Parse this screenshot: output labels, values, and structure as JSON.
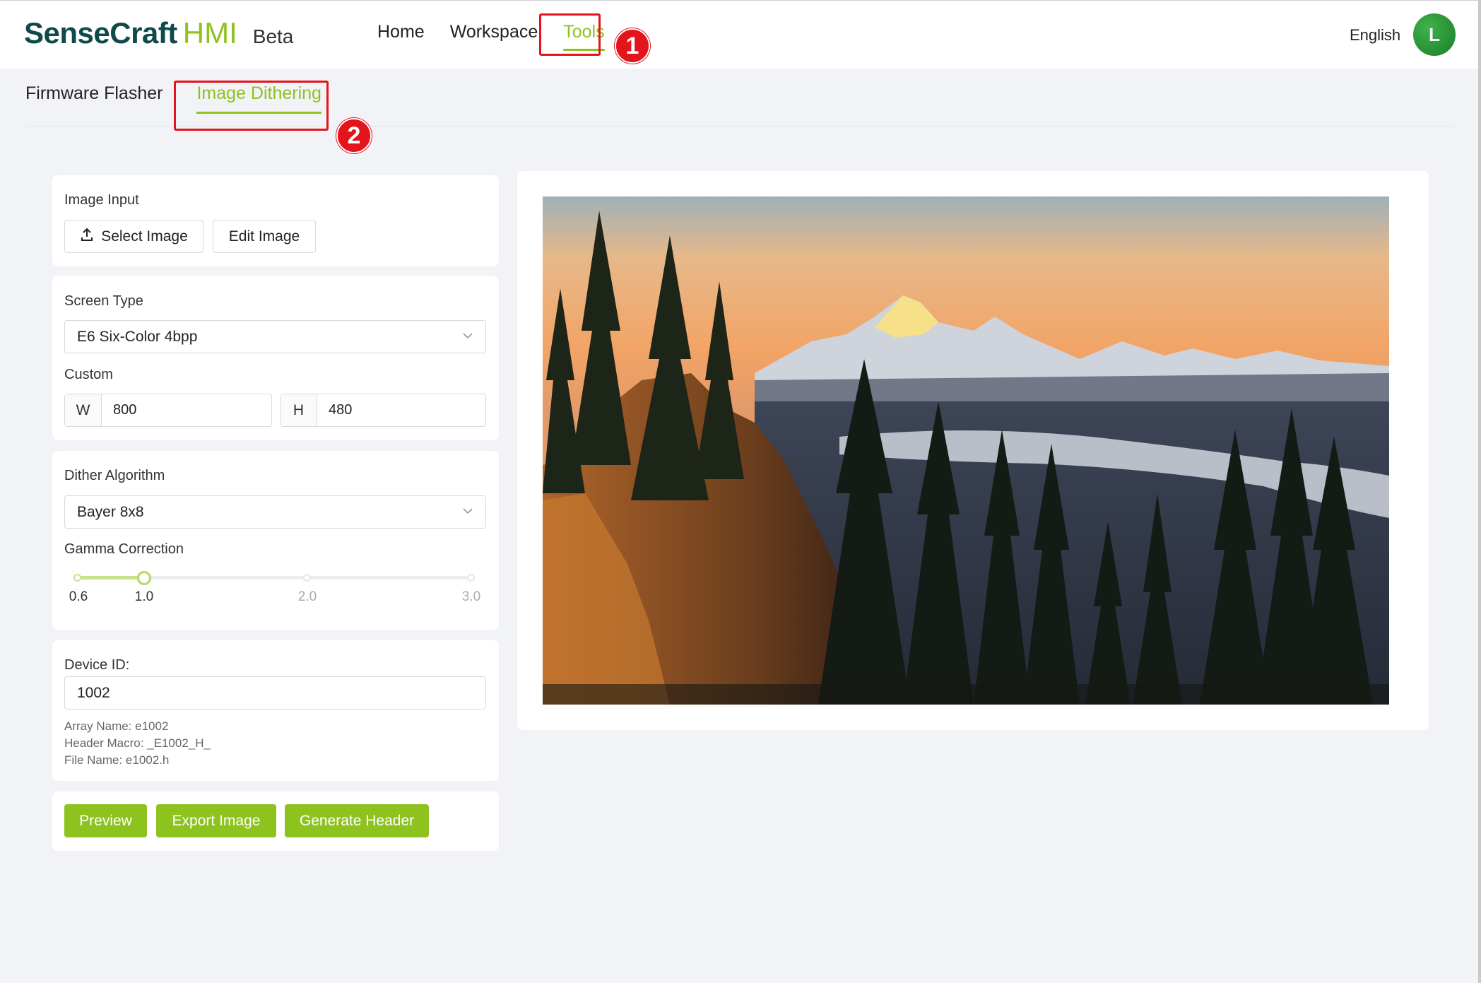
{
  "header": {
    "brand": "SenseCraft",
    "brand_suffix": "HMI",
    "badge": "Beta",
    "nav": [
      {
        "label": "Home",
        "active": false
      },
      {
        "label": "Workspace",
        "active": false
      },
      {
        "label": "Tools",
        "active": true
      }
    ],
    "language": "English",
    "avatar_initial": "L"
  },
  "annotations": {
    "step1": "1",
    "step2": "2"
  },
  "subtabs": [
    {
      "label": "Firmware Flasher",
      "active": false
    },
    {
      "label": "Image Dithering",
      "active": true
    }
  ],
  "image_input": {
    "title": "Image Input",
    "select_label": "Select Image",
    "edit_label": "Edit Image"
  },
  "screen": {
    "title": "Screen Type",
    "selected": "E6 Six-Color 4bpp",
    "custom_label": "Custom",
    "w_label": "W",
    "w_value": "800",
    "h_label": "H",
    "h_value": "480"
  },
  "dither": {
    "title": "Dither Algorithm",
    "selected": "Bayer 8x8",
    "gamma_title": "Gamma Correction",
    "gamma_marks": [
      "0.6",
      "1.0",
      "2.0",
      "3.0"
    ],
    "gamma_value": 1.0,
    "gamma_min": 0.6,
    "gamma_max": 3.0
  },
  "device": {
    "title": "Device ID:",
    "value": "1002",
    "array_name": "Array Name: e1002",
    "header_macro": "Header Macro: _E1002_H_",
    "file_name": "File Name: e1002.h"
  },
  "actions": {
    "preview": "Preview",
    "export": "Export Image",
    "generate": "Generate Header"
  },
  "colors": {
    "accent": "#8dc21f",
    "brand_dark": "#0f4a4a",
    "annotation_red": "#e3141c",
    "background": "#f2f3f6"
  },
  "preview_image": {
    "icon": "landscape-photo"
  }
}
